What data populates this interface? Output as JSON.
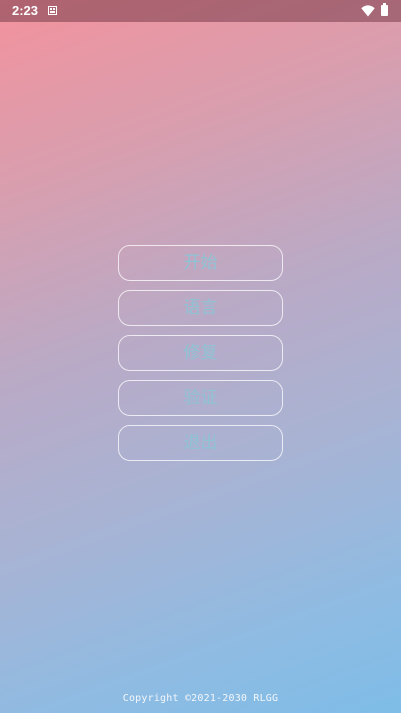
{
  "status_bar": {
    "time": "2:23",
    "icons": [
      "notification-icon",
      "wifi-icon",
      "battery-icon"
    ]
  },
  "menu": {
    "buttons": [
      {
        "label": "开始"
      },
      {
        "label": "语言"
      },
      {
        "label": "修复"
      },
      {
        "label": "验证"
      },
      {
        "label": "退出"
      }
    ]
  },
  "footer": {
    "copyright": "Copyright ©2021-2030 RLGG"
  },
  "colors": {
    "gradient_top": "#f3929d",
    "gradient_bottom": "#7ebde7",
    "button_text": "#8fc3d4",
    "button_border": "#ffffff"
  }
}
